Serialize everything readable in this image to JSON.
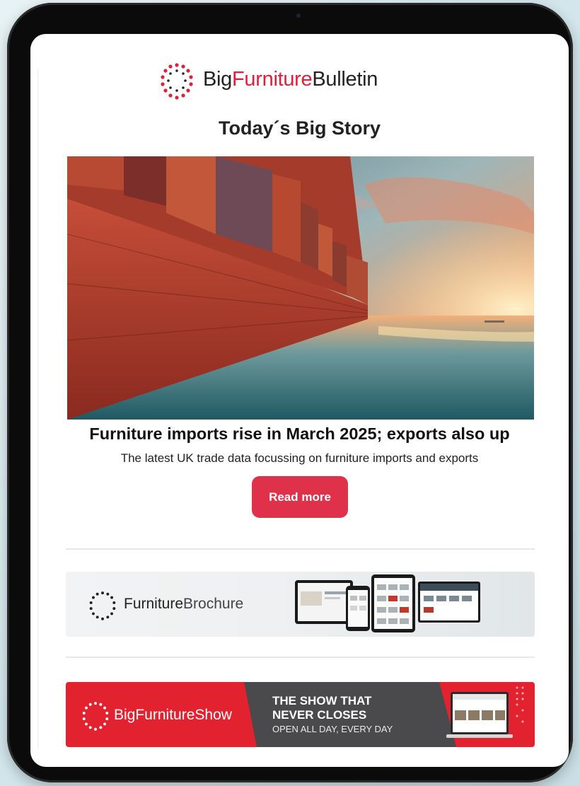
{
  "newsletter": {
    "logo": {
      "prefix": "Big",
      "middle": "Furniture",
      "suffix": "Bulletin",
      "icon": "dotted-ring-logo-icon"
    },
    "section_heading": "Today´s Big Story",
    "hero_image": {
      "description_icon": "container-ship-sunset-image"
    },
    "story": {
      "headline": "Furniture imports rise in March 2025; exports also up",
      "summary": "The latest UK trade data focussing on furniture imports and exports",
      "cta_label": "Read more"
    },
    "banners": {
      "brochure": {
        "brand_bold": "Furniture",
        "brand_light": "Brochure",
        "icon": "dotted-ring-logo-icon"
      },
      "show": {
        "brand_prefix": "Big",
        "brand_middle": "Furniture",
        "brand_suffix": "Show",
        "tagline_1": "THE SHOW THAT",
        "tagline_2": "NEVER CLOSES",
        "tagline_3": "OPEN ALL DAY, EVERY DAY",
        "icon": "dotted-ring-logo-icon"
      }
    }
  },
  "colors": {
    "brand_red": "#e31e3a",
    "button_red": "#e0314b",
    "banner_red": "#e2232f",
    "banner_dark": "#4a4a4c",
    "device_frame": "#0b0b0c"
  }
}
